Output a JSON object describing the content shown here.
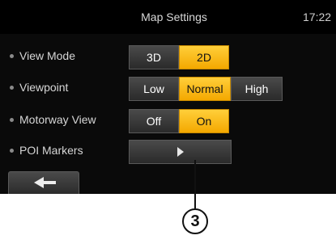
{
  "header": {
    "title": "Map Settings",
    "time": "17:22"
  },
  "settings": [
    {
      "label": "View Mode",
      "options": [
        "3D",
        "2D"
      ],
      "selected": "2D"
    },
    {
      "label": "Viewpoint",
      "options": [
        "Low",
        "Normal",
        "High"
      ],
      "selected": "Normal"
    },
    {
      "label": "Motorway View",
      "options": [
        "Off",
        "On"
      ],
      "selected": "On"
    },
    {
      "label": "POI Markers",
      "button_icon": "play-icon"
    }
  ],
  "footer": {
    "back_icon": "back-arrow-icon"
  },
  "annotation": {
    "callout_number": "3"
  },
  "colors": {
    "accent": "#f4a800",
    "background": "#0a0a0a"
  }
}
